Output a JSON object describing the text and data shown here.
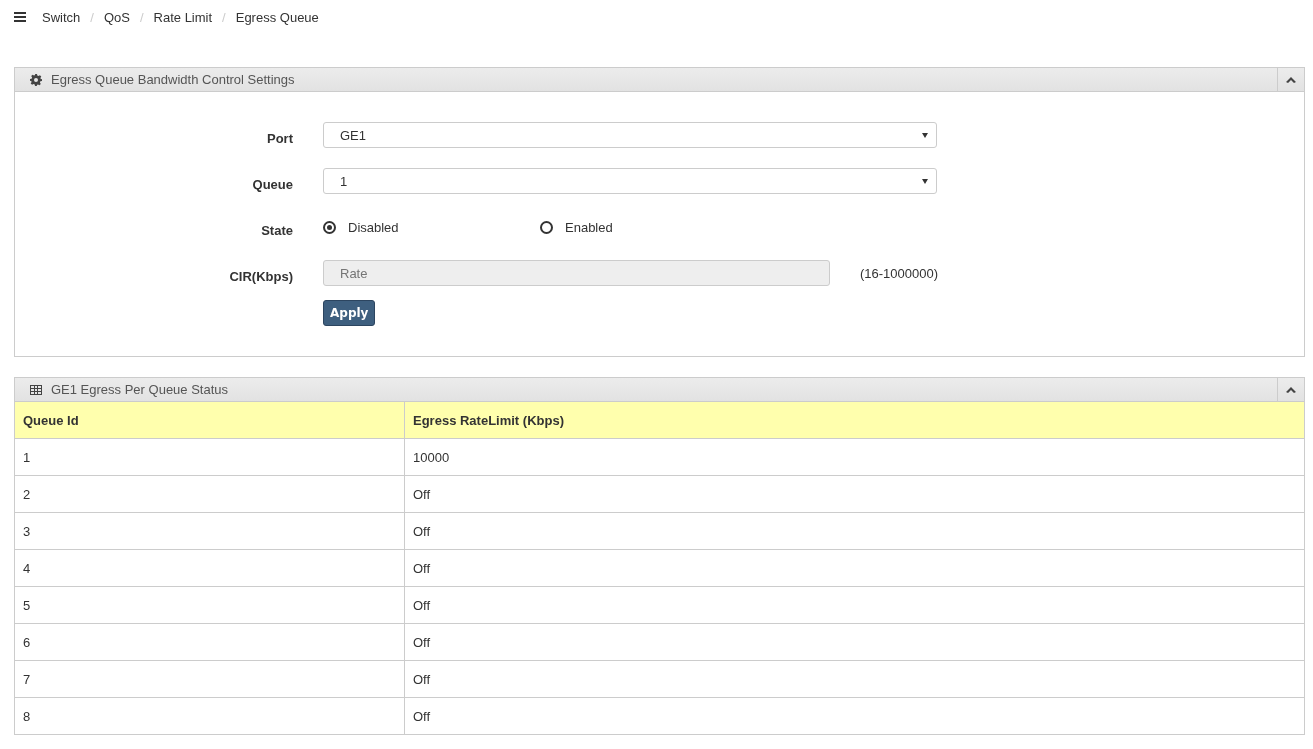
{
  "breadcrumb": {
    "separator": "/",
    "items": [
      "Switch",
      "QoS",
      "Rate Limit",
      "Egress Queue"
    ]
  },
  "settings_panel": {
    "title": "Egress Queue Bandwidth Control Settings",
    "expanded": true,
    "fields": [
      {
        "kind": "select",
        "label": "Port",
        "value": "GE1"
      },
      {
        "kind": "select",
        "label": "Queue",
        "value": "1"
      },
      {
        "kind": "radio",
        "label": "State",
        "options": [
          {
            "label": "Disabled",
            "selected": true
          },
          {
            "label": "Enabled",
            "selected": false
          }
        ]
      },
      {
        "kind": "text",
        "label": "CIR(Kbps)",
        "placeholder": "Rate",
        "disabled": true,
        "hint": "(16-1000000)"
      }
    ],
    "apply_button": "Apply"
  },
  "status_panel": {
    "title": "GE1 Egress Per Queue Status",
    "expanded": true,
    "columns": [
      "Queue Id",
      "Egress RateLimit (Kbps)"
    ],
    "rows": [
      [
        "1",
        "10000"
      ],
      [
        "2",
        "Off"
      ],
      [
        "3",
        "Off"
      ],
      [
        "4",
        "Off"
      ],
      [
        "5",
        "Off"
      ],
      [
        "6",
        "Off"
      ],
      [
        "7",
        "Off"
      ],
      [
        "8",
        "Off"
      ]
    ]
  }
}
